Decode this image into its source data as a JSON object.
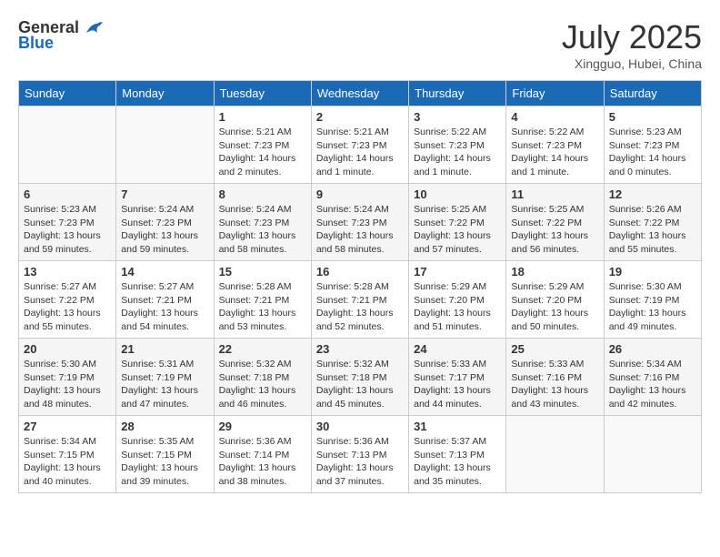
{
  "header": {
    "logo_general": "General",
    "logo_blue": "Blue",
    "month_title": "July 2025",
    "location": "Xingguo, Hubei, China"
  },
  "weekdays": [
    "Sunday",
    "Monday",
    "Tuesday",
    "Wednesday",
    "Thursday",
    "Friday",
    "Saturday"
  ],
  "weeks": [
    [
      {
        "day": "",
        "info": ""
      },
      {
        "day": "",
        "info": ""
      },
      {
        "day": "1",
        "info": "Sunrise: 5:21 AM\nSunset: 7:23 PM\nDaylight: 14 hours\nand 2 minutes."
      },
      {
        "day": "2",
        "info": "Sunrise: 5:21 AM\nSunset: 7:23 PM\nDaylight: 14 hours\nand 1 minute."
      },
      {
        "day": "3",
        "info": "Sunrise: 5:22 AM\nSunset: 7:23 PM\nDaylight: 14 hours\nand 1 minute."
      },
      {
        "day": "4",
        "info": "Sunrise: 5:22 AM\nSunset: 7:23 PM\nDaylight: 14 hours\nand 1 minute."
      },
      {
        "day": "5",
        "info": "Sunrise: 5:23 AM\nSunset: 7:23 PM\nDaylight: 14 hours\nand 0 minutes."
      }
    ],
    [
      {
        "day": "6",
        "info": "Sunrise: 5:23 AM\nSunset: 7:23 PM\nDaylight: 13 hours\nand 59 minutes."
      },
      {
        "day": "7",
        "info": "Sunrise: 5:24 AM\nSunset: 7:23 PM\nDaylight: 13 hours\nand 59 minutes."
      },
      {
        "day": "8",
        "info": "Sunrise: 5:24 AM\nSunset: 7:23 PM\nDaylight: 13 hours\nand 58 minutes."
      },
      {
        "day": "9",
        "info": "Sunrise: 5:24 AM\nSunset: 7:23 PM\nDaylight: 13 hours\nand 58 minutes."
      },
      {
        "day": "10",
        "info": "Sunrise: 5:25 AM\nSunset: 7:22 PM\nDaylight: 13 hours\nand 57 minutes."
      },
      {
        "day": "11",
        "info": "Sunrise: 5:25 AM\nSunset: 7:22 PM\nDaylight: 13 hours\nand 56 minutes."
      },
      {
        "day": "12",
        "info": "Sunrise: 5:26 AM\nSunset: 7:22 PM\nDaylight: 13 hours\nand 55 minutes."
      }
    ],
    [
      {
        "day": "13",
        "info": "Sunrise: 5:27 AM\nSunset: 7:22 PM\nDaylight: 13 hours\nand 55 minutes."
      },
      {
        "day": "14",
        "info": "Sunrise: 5:27 AM\nSunset: 7:21 PM\nDaylight: 13 hours\nand 54 minutes."
      },
      {
        "day": "15",
        "info": "Sunrise: 5:28 AM\nSunset: 7:21 PM\nDaylight: 13 hours\nand 53 minutes."
      },
      {
        "day": "16",
        "info": "Sunrise: 5:28 AM\nSunset: 7:21 PM\nDaylight: 13 hours\nand 52 minutes."
      },
      {
        "day": "17",
        "info": "Sunrise: 5:29 AM\nSunset: 7:20 PM\nDaylight: 13 hours\nand 51 minutes."
      },
      {
        "day": "18",
        "info": "Sunrise: 5:29 AM\nSunset: 7:20 PM\nDaylight: 13 hours\nand 50 minutes."
      },
      {
        "day": "19",
        "info": "Sunrise: 5:30 AM\nSunset: 7:19 PM\nDaylight: 13 hours\nand 49 minutes."
      }
    ],
    [
      {
        "day": "20",
        "info": "Sunrise: 5:30 AM\nSunset: 7:19 PM\nDaylight: 13 hours\nand 48 minutes."
      },
      {
        "day": "21",
        "info": "Sunrise: 5:31 AM\nSunset: 7:19 PM\nDaylight: 13 hours\nand 47 minutes."
      },
      {
        "day": "22",
        "info": "Sunrise: 5:32 AM\nSunset: 7:18 PM\nDaylight: 13 hours\nand 46 minutes."
      },
      {
        "day": "23",
        "info": "Sunrise: 5:32 AM\nSunset: 7:18 PM\nDaylight: 13 hours\nand 45 minutes."
      },
      {
        "day": "24",
        "info": "Sunrise: 5:33 AM\nSunset: 7:17 PM\nDaylight: 13 hours\nand 44 minutes."
      },
      {
        "day": "25",
        "info": "Sunrise: 5:33 AM\nSunset: 7:16 PM\nDaylight: 13 hours\nand 43 minutes."
      },
      {
        "day": "26",
        "info": "Sunrise: 5:34 AM\nSunset: 7:16 PM\nDaylight: 13 hours\nand 42 minutes."
      }
    ],
    [
      {
        "day": "27",
        "info": "Sunrise: 5:34 AM\nSunset: 7:15 PM\nDaylight: 13 hours\nand 40 minutes."
      },
      {
        "day": "28",
        "info": "Sunrise: 5:35 AM\nSunset: 7:15 PM\nDaylight: 13 hours\nand 39 minutes."
      },
      {
        "day": "29",
        "info": "Sunrise: 5:36 AM\nSunset: 7:14 PM\nDaylight: 13 hours\nand 38 minutes."
      },
      {
        "day": "30",
        "info": "Sunrise: 5:36 AM\nSunset: 7:13 PM\nDaylight: 13 hours\nand 37 minutes."
      },
      {
        "day": "31",
        "info": "Sunrise: 5:37 AM\nSunset: 7:13 PM\nDaylight: 13 hours\nand 35 minutes."
      },
      {
        "day": "",
        "info": ""
      },
      {
        "day": "",
        "info": ""
      }
    ]
  ]
}
